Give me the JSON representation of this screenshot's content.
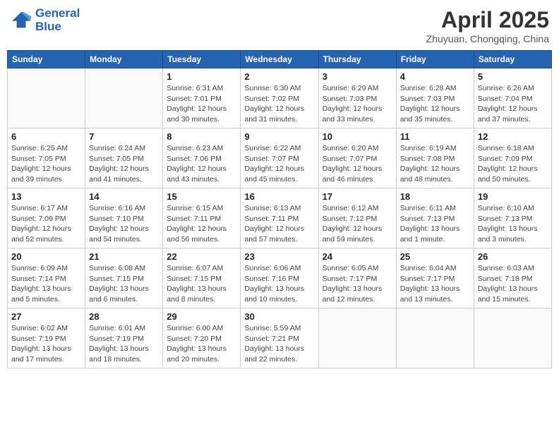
{
  "header": {
    "logo_line1": "General",
    "logo_line2": "Blue",
    "month": "April 2025",
    "location": "Zhuyuan, Chongqing, China"
  },
  "weekdays": [
    "Sunday",
    "Monday",
    "Tuesday",
    "Wednesday",
    "Thursday",
    "Friday",
    "Saturday"
  ],
  "weeks": [
    [
      {
        "day": "",
        "info": ""
      },
      {
        "day": "",
        "info": ""
      },
      {
        "day": "1",
        "info": "Sunrise: 6:31 AM\nSunset: 7:01 PM\nDaylight: 12 hours\nand 30 minutes."
      },
      {
        "day": "2",
        "info": "Sunrise: 6:30 AM\nSunset: 7:02 PM\nDaylight: 12 hours\nand 31 minutes."
      },
      {
        "day": "3",
        "info": "Sunrise: 6:29 AM\nSunset: 7:03 PM\nDaylight: 12 hours\nand 33 minutes."
      },
      {
        "day": "4",
        "info": "Sunrise: 6:28 AM\nSunset: 7:03 PM\nDaylight: 12 hours\nand 35 minutes."
      },
      {
        "day": "5",
        "info": "Sunrise: 6:26 AM\nSunset: 7:04 PM\nDaylight: 12 hours\nand 37 minutes."
      }
    ],
    [
      {
        "day": "6",
        "info": "Sunrise: 6:25 AM\nSunset: 7:05 PM\nDaylight: 12 hours\nand 39 minutes."
      },
      {
        "day": "7",
        "info": "Sunrise: 6:24 AM\nSunset: 7:05 PM\nDaylight: 12 hours\nand 41 minutes."
      },
      {
        "day": "8",
        "info": "Sunrise: 6:23 AM\nSunset: 7:06 PM\nDaylight: 12 hours\nand 43 minutes."
      },
      {
        "day": "9",
        "info": "Sunrise: 6:22 AM\nSunset: 7:07 PM\nDaylight: 12 hours\nand 45 minutes."
      },
      {
        "day": "10",
        "info": "Sunrise: 6:20 AM\nSunset: 7:07 PM\nDaylight: 12 hours\nand 46 minutes."
      },
      {
        "day": "11",
        "info": "Sunrise: 6:19 AM\nSunset: 7:08 PM\nDaylight: 12 hours\nand 48 minutes."
      },
      {
        "day": "12",
        "info": "Sunrise: 6:18 AM\nSunset: 7:09 PM\nDaylight: 12 hours\nand 50 minutes."
      }
    ],
    [
      {
        "day": "13",
        "info": "Sunrise: 6:17 AM\nSunset: 7:09 PM\nDaylight: 12 hours\nand 52 minutes."
      },
      {
        "day": "14",
        "info": "Sunrise: 6:16 AM\nSunset: 7:10 PM\nDaylight: 12 hours\nand 54 minutes."
      },
      {
        "day": "15",
        "info": "Sunrise: 6:15 AM\nSunset: 7:11 PM\nDaylight: 12 hours\nand 56 minutes."
      },
      {
        "day": "16",
        "info": "Sunrise: 6:13 AM\nSunset: 7:11 PM\nDaylight: 12 hours\nand 57 minutes."
      },
      {
        "day": "17",
        "info": "Sunrise: 6:12 AM\nSunset: 7:12 PM\nDaylight: 12 hours\nand 59 minutes."
      },
      {
        "day": "18",
        "info": "Sunrise: 6:11 AM\nSunset: 7:13 PM\nDaylight: 13 hours\nand 1 minute."
      },
      {
        "day": "19",
        "info": "Sunrise: 6:10 AM\nSunset: 7:13 PM\nDaylight: 13 hours\nand 3 minutes."
      }
    ],
    [
      {
        "day": "20",
        "info": "Sunrise: 6:09 AM\nSunset: 7:14 PM\nDaylight: 13 hours\nand 5 minutes."
      },
      {
        "day": "21",
        "info": "Sunrise: 6:08 AM\nSunset: 7:15 PM\nDaylight: 13 hours\nand 6 minutes."
      },
      {
        "day": "22",
        "info": "Sunrise: 6:07 AM\nSunset: 7:15 PM\nDaylight: 13 hours\nand 8 minutes."
      },
      {
        "day": "23",
        "info": "Sunrise: 6:06 AM\nSunset: 7:16 PM\nDaylight: 13 hours\nand 10 minutes."
      },
      {
        "day": "24",
        "info": "Sunrise: 6:05 AM\nSunset: 7:17 PM\nDaylight: 13 hours\nand 12 minutes."
      },
      {
        "day": "25",
        "info": "Sunrise: 6:04 AM\nSunset: 7:17 PM\nDaylight: 13 hours\nand 13 minutes."
      },
      {
        "day": "26",
        "info": "Sunrise: 6:03 AM\nSunset: 7:18 PM\nDaylight: 13 hours\nand 15 minutes."
      }
    ],
    [
      {
        "day": "27",
        "info": "Sunrise: 6:02 AM\nSunset: 7:19 PM\nDaylight: 13 hours\nand 17 minutes."
      },
      {
        "day": "28",
        "info": "Sunrise: 6:01 AM\nSunset: 7:19 PM\nDaylight: 13 hours\nand 18 minutes."
      },
      {
        "day": "29",
        "info": "Sunrise: 6:00 AM\nSunset: 7:20 PM\nDaylight: 13 hours\nand 20 minutes."
      },
      {
        "day": "30",
        "info": "Sunrise: 5:59 AM\nSunset: 7:21 PM\nDaylight: 13 hours\nand 22 minutes."
      },
      {
        "day": "",
        "info": ""
      },
      {
        "day": "",
        "info": ""
      },
      {
        "day": "",
        "info": ""
      }
    ]
  ]
}
